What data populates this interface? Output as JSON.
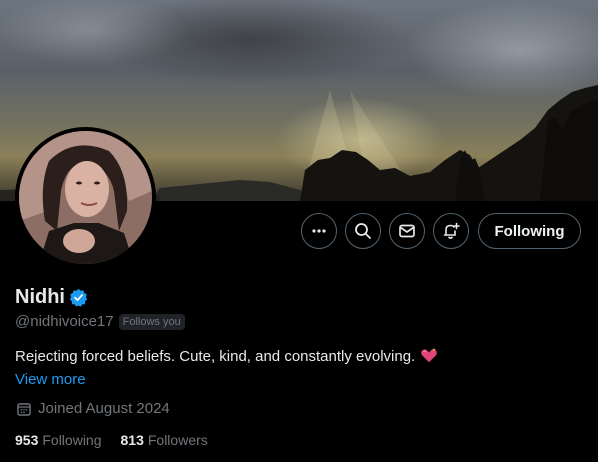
{
  "profile": {
    "display_name": "Nidhi",
    "handle": "@nidhivoice17",
    "follows_you_badge": "Follows you",
    "bio": "Rejecting forced beliefs. Cute, kind, and constantly evolving.",
    "view_more": "View more",
    "joined": "Joined August 2024",
    "stats": {
      "following_count": "953",
      "following_label": "Following",
      "followers_count": "813",
      "followers_label": "Followers"
    }
  },
  "actions": {
    "more_icon": "more-dots-icon",
    "search_icon": "search-icon",
    "message_icon": "envelope-icon",
    "notify_icon": "bell-plus-icon",
    "following_label": "Following"
  },
  "colors": {
    "background": "#000000",
    "accent_link": "#1d9bf0",
    "verified_badge": "#1d9bf0",
    "muted_text": "#71767b",
    "button_border": "#536471"
  }
}
